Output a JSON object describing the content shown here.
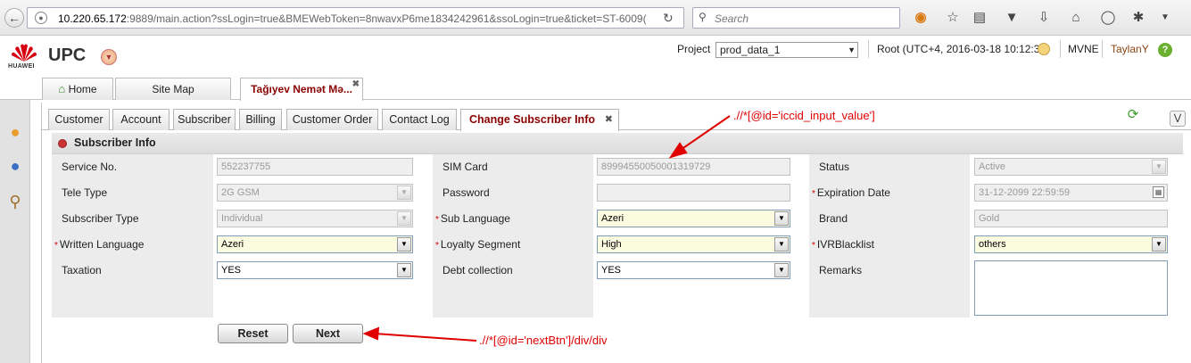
{
  "browser": {
    "url_host": "10.220.65.172",
    "url_rest": ":9889/main.action?ssLogin=true&BMEWebToken=8nwavxP6me1834242961&ssoLogin=true&ticket=ST-6009(",
    "search_placeholder": "Search"
  },
  "app": {
    "logo_text": "HUAWEI",
    "title": "UPC",
    "project_label": "Project",
    "project_value": "prod_data_1",
    "user_info": "Root (UTC+4, 2016-03-18 10:12:32)",
    "realm": "MVNE",
    "username": "TaylanY"
  },
  "top_tabs": [
    {
      "label": "Home"
    },
    {
      "label": "Site Map"
    },
    {
      "label": "Tağıyev Nemət Mə..."
    }
  ],
  "sub_tabs": [
    {
      "label": "Customer"
    },
    {
      "label": "Account"
    },
    {
      "label": "Subscriber"
    },
    {
      "label": "Billing"
    },
    {
      "label": "Customer Order"
    },
    {
      "label": "Contact Log"
    },
    {
      "label": "Change Subscriber Info"
    }
  ],
  "section": {
    "title": "Subscriber Info"
  },
  "form": {
    "service_no": {
      "label": "Service No.",
      "value": "552237755"
    },
    "tele_type": {
      "label": "Tele Type",
      "value": "2G GSM"
    },
    "subscriber_type": {
      "label": "Subscriber Type",
      "value": "Individual"
    },
    "written_language": {
      "label": "Written Language",
      "value": "Azeri"
    },
    "taxation": {
      "label": "Taxation",
      "value": "YES"
    },
    "sim_card": {
      "label": "SIM Card",
      "value": "89994550050001319729"
    },
    "password": {
      "label": "Password",
      "value": ""
    },
    "sub_language": {
      "label": "Sub Language",
      "value": "Azeri"
    },
    "loyalty_segment": {
      "label": "Loyalty Segment",
      "value": "High"
    },
    "debt_collection": {
      "label": "Debt collection",
      "value": "YES"
    },
    "status": {
      "label": "Status",
      "value": "Active"
    },
    "expiration_date": {
      "label": "Expiration Date",
      "value": "31-12-2099 22:59:59"
    },
    "brand": {
      "label": "Brand",
      "value": "Gold"
    },
    "ivr_blacklist": {
      "label": "IVRBlacklist",
      "value": "others"
    },
    "remarks": {
      "label": "Remarks",
      "value": ""
    }
  },
  "buttons": {
    "reset": "Reset",
    "next": "Next"
  },
  "annotations": {
    "iccid": ".//*[@id='iccid_input_value']",
    "next": ".//*[@id='nextBtn']/div/div"
  },
  "colors": {
    "annotation": "#e00000",
    "active_tab": "#8b0000",
    "required": "#cc0000"
  }
}
